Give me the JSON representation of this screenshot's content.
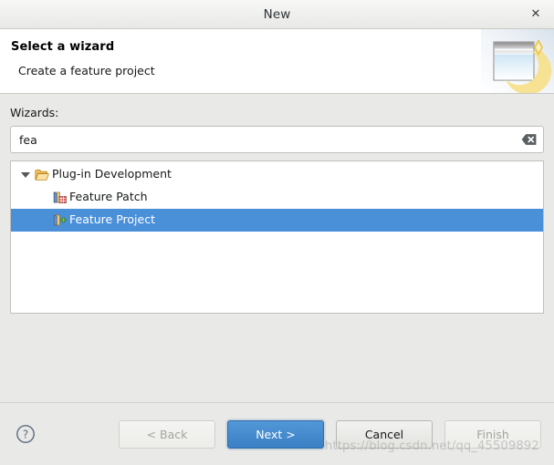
{
  "window": {
    "title": "New",
    "close_label": "✕"
  },
  "banner": {
    "title": "Select a wizard",
    "subtitle": "Create a feature project",
    "image_name": "new-wizard-banner-icon"
  },
  "form": {
    "wizards_label": "Wizards:",
    "search_value": "fea",
    "search_placeholder": "type filter text",
    "clear_icon": "clear-backspace-icon"
  },
  "tree": {
    "items": [
      {
        "label": "Plug-in Development",
        "icon": "open-folder-icon",
        "level": 0,
        "expanded": true,
        "selected": false
      },
      {
        "label": "Feature Patch",
        "icon": "feature-patch-icon",
        "level": 1,
        "expanded": false,
        "selected": false
      },
      {
        "label": "Feature Project",
        "icon": "feature-project-icon",
        "level": 1,
        "expanded": false,
        "selected": true
      }
    ]
  },
  "footer": {
    "help_icon": "help-question-icon",
    "buttons": [
      {
        "label": "< Back",
        "state": "disabled"
      },
      {
        "label": "Next >",
        "state": "primary"
      },
      {
        "label": "Cancel",
        "state": "normal"
      },
      {
        "label": "Finish",
        "state": "disabled"
      }
    ]
  },
  "watermark": {
    "text": "https://blog.csdn.net/qq_45509892"
  },
  "colors": {
    "selection_blue": "#4a90d9",
    "primary_button": "#3b7fc4",
    "dialog_background": "#e9e9e7",
    "banner_background": "#ffffff"
  }
}
